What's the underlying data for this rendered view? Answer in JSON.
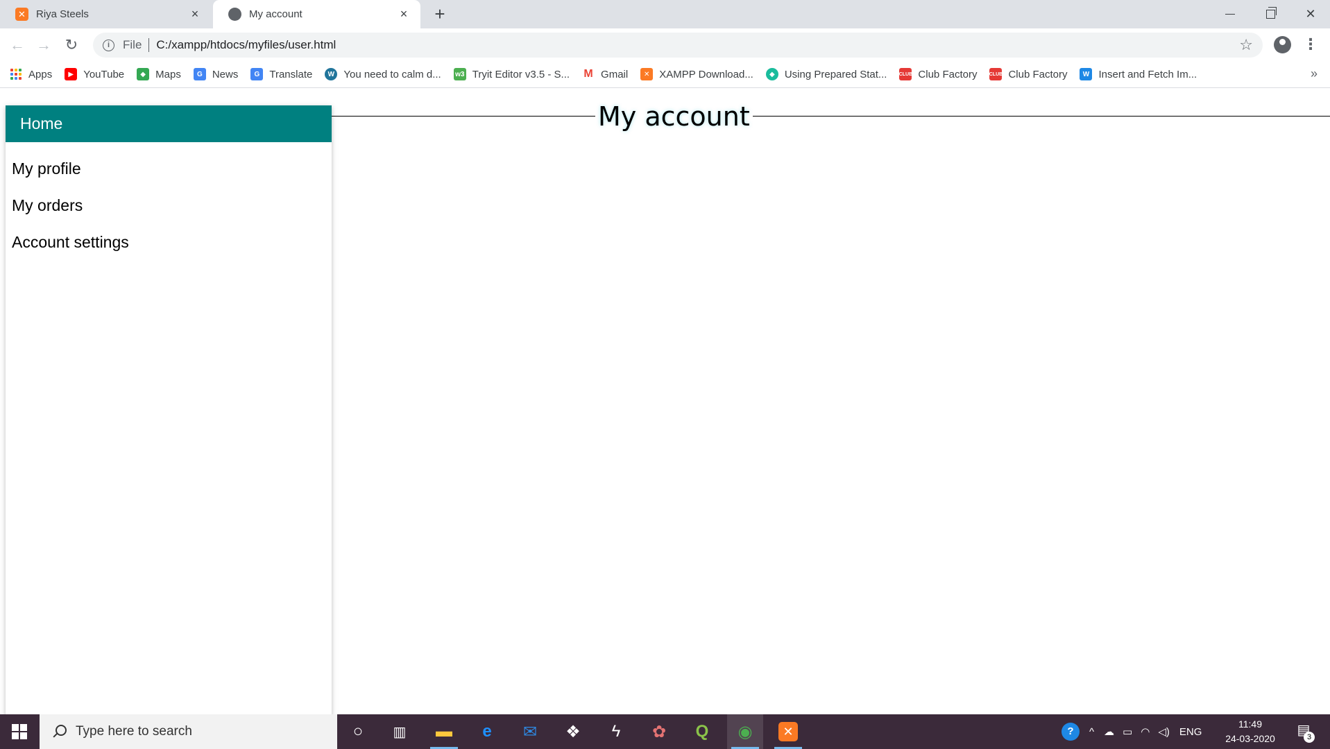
{
  "browser": {
    "tabs": [
      {
        "title": "Riya Steels",
        "icon": "xampp-icon"
      },
      {
        "title": "My account",
        "icon": "globe-icon"
      }
    ],
    "new_tab_symbol": "+",
    "close_symbol": "×",
    "omnibox": {
      "scheme": "File",
      "url": "C:/xampp/htdocs/myfiles/user.html"
    },
    "bookmarks": [
      {
        "label": "Apps",
        "color": "#ea4335"
      },
      {
        "label": "YouTube",
        "color": "#ff0000"
      },
      {
        "label": "Maps",
        "color": "#34a853"
      },
      {
        "label": "News",
        "color": "#4285f4"
      },
      {
        "label": "Translate",
        "color": "#4285f4"
      },
      {
        "label": "You need to calm d...",
        "color": "#21759b"
      },
      {
        "label": "Tryit Editor v3.5 - S...",
        "color": "#4caf50"
      },
      {
        "label": "Gmail",
        "color": "#ea4335"
      },
      {
        "label": "XAMPP Download...",
        "color": "#fb7a24"
      },
      {
        "label": "Using Prepared Stat...",
        "color": "#1abc9c"
      },
      {
        "label": "Club Factory",
        "color": "#e53935"
      },
      {
        "label": "Club Factory",
        "color": "#e53935"
      },
      {
        "label": "Insert and Fetch Im...",
        "color": "#1e88e5"
      }
    ],
    "more_bookmarks": "»"
  },
  "page": {
    "sidebar": {
      "home": "Home",
      "links": [
        "My profile",
        "My orders",
        "Account settings"
      ],
      "accent": "#008080"
    },
    "main": {
      "title": "My account"
    }
  },
  "taskbar": {
    "search_placeholder": "Type here to search",
    "language": "ENG",
    "time": "11:49",
    "date": "24-03-2020",
    "notification_count": "3",
    "background": "#3b2a3a"
  }
}
